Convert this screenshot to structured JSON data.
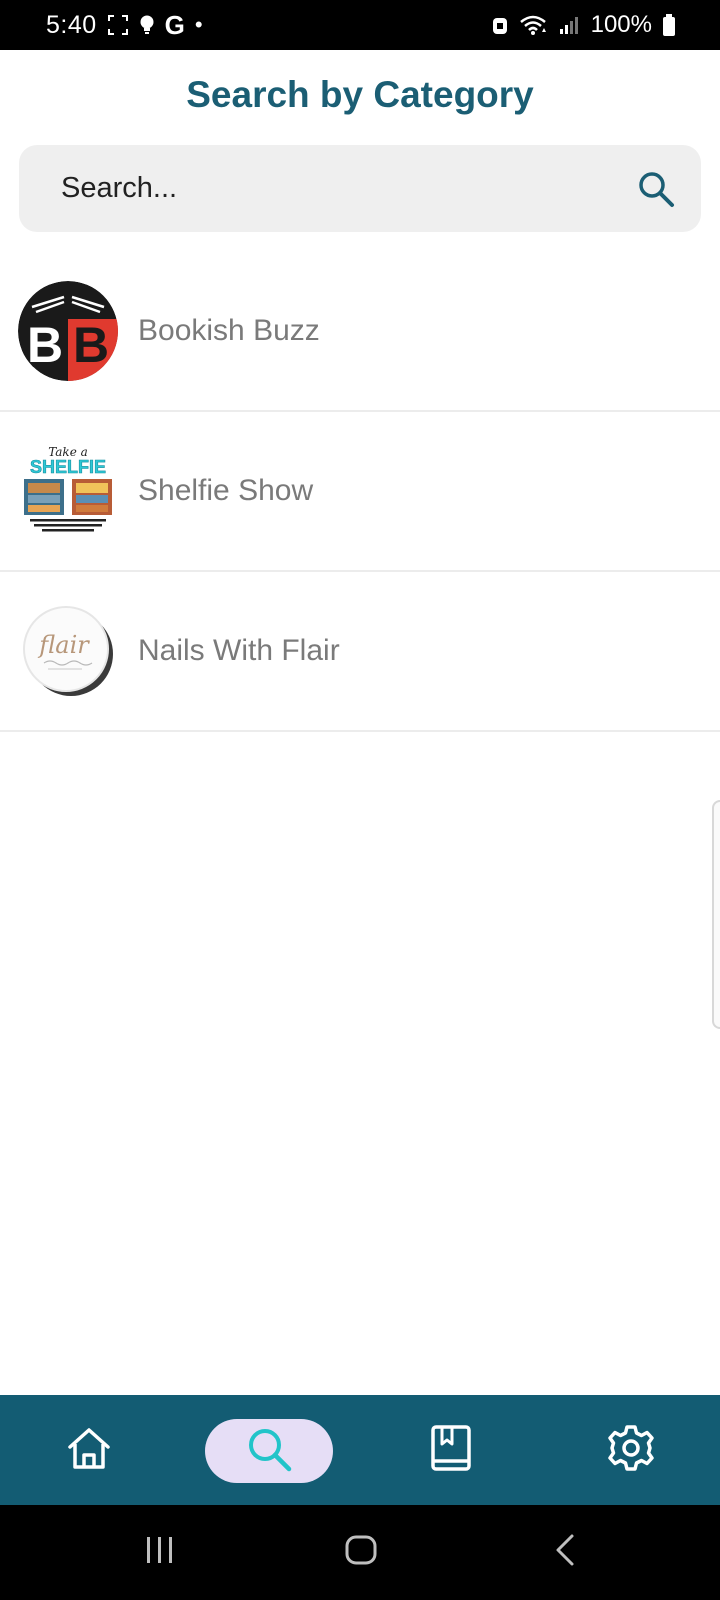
{
  "status_bar": {
    "time": "5:40",
    "g_label": "G",
    "dot": "•",
    "battery_pct": "100%"
  },
  "header": {
    "title": "Search by Category"
  },
  "search": {
    "placeholder": "Search..."
  },
  "categories": [
    {
      "label": "Bookish Buzz",
      "avatar": "bookish-buzz-logo"
    },
    {
      "label": "Shelfie Show",
      "avatar": "shelfie-show-logo"
    },
    {
      "label": "Nails With Flair",
      "avatar": "nails-with-flair-logo"
    }
  ],
  "avatar_text": {
    "bookish_buzz": "BB",
    "shelfie_top": "Take a",
    "shelfie_main": "SHELFIE",
    "flair": "flair"
  },
  "bottom_nav": {
    "items": [
      "home-icon",
      "search-icon",
      "bookmark-icon",
      "settings-icon"
    ],
    "active": "search-icon"
  },
  "system_nav": {
    "items": [
      "recents-icon",
      "home-circle-icon",
      "back-icon"
    ]
  },
  "colors": {
    "title": "#1b5e74",
    "nav_bar": "#135c73",
    "nav_active_pill": "#e6def6",
    "nav_active_icon": "#22c4c9",
    "bookish_red": "#e03a2f"
  }
}
